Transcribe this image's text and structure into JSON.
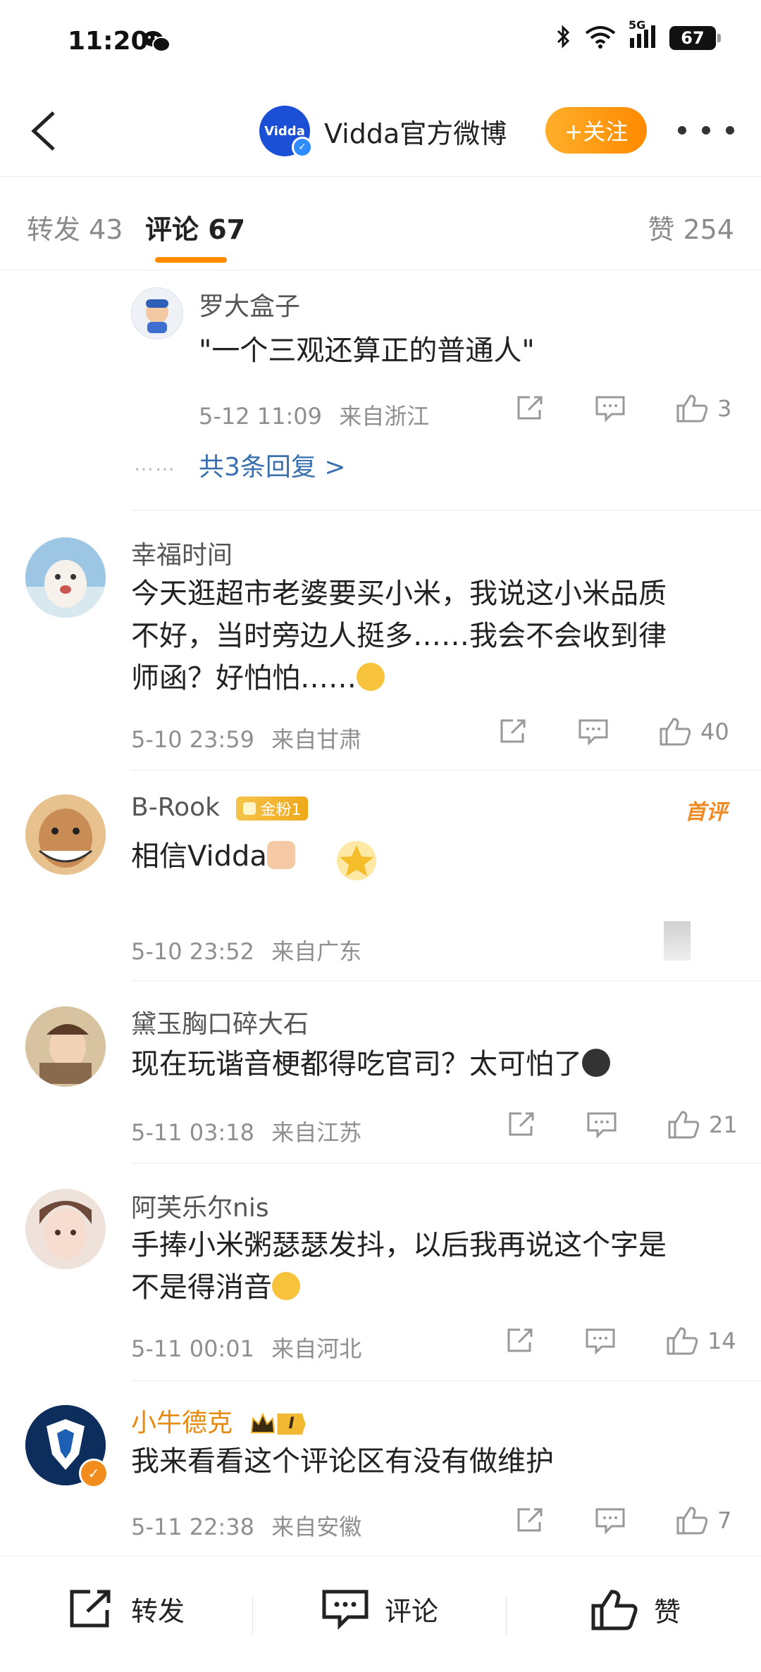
{
  "status_bar": {
    "time": "11:20",
    "battery": "67",
    "network": "5G"
  },
  "header": {
    "account_name": "Vidda官方微博",
    "logo_text": "Vidda",
    "follow_label": "+关注"
  },
  "tabs": {
    "repost": "转发 43",
    "comment": "评论 67",
    "like": "赞 254"
  },
  "reply_block": {
    "username": "罗大盒子",
    "text": "\"一个三观还算正的普通人\"",
    "time": "5-12 11:09",
    "location": "来自浙江",
    "likes": "3",
    "dots": "……",
    "more_replies": "共3条回复 >"
  },
  "comments": [
    {
      "username": "幸福时间",
      "line1": "今天逛超市老婆要买小米，我说这小米品质",
      "line2": "不好，当时旁边人挺多……我会不会收到律",
      "line3": "师函？好怕怕……",
      "time": "5-10 23:59",
      "location": "来自甘肃",
      "likes": "40"
    },
    {
      "username": "B-Rook",
      "badge": "金粉1",
      "tag": "首评",
      "text": "相信Vidda",
      "time": "5-10 23:52",
      "location": "来自广东"
    },
    {
      "username": "黛玉胸口碎大石",
      "text": "现在玩谐音梗都得吃官司？太可怕了",
      "time": "5-11 03:18",
      "location": "来自江苏",
      "likes": "21"
    },
    {
      "username": "阿芙乐尔nis",
      "line1": "手捧小米粥瑟瑟发抖，以后我再说这个字是",
      "line2": "不是得消音",
      "time": "5-11 00:01",
      "location": "来自河北",
      "likes": "14"
    },
    {
      "username": "小牛德克",
      "badge_text": "I",
      "text": "我来看看这个评论区有没有做维护",
      "time": "5-11 22:38",
      "location": "来自安徽",
      "likes": "7"
    }
  ],
  "bottom_bar": {
    "repost": "转发",
    "comment": "评论",
    "like": "赞"
  },
  "colors": {
    "accent": "#ff8a00",
    "link": "#3a6fb0",
    "vip_name": "#e8890c"
  }
}
